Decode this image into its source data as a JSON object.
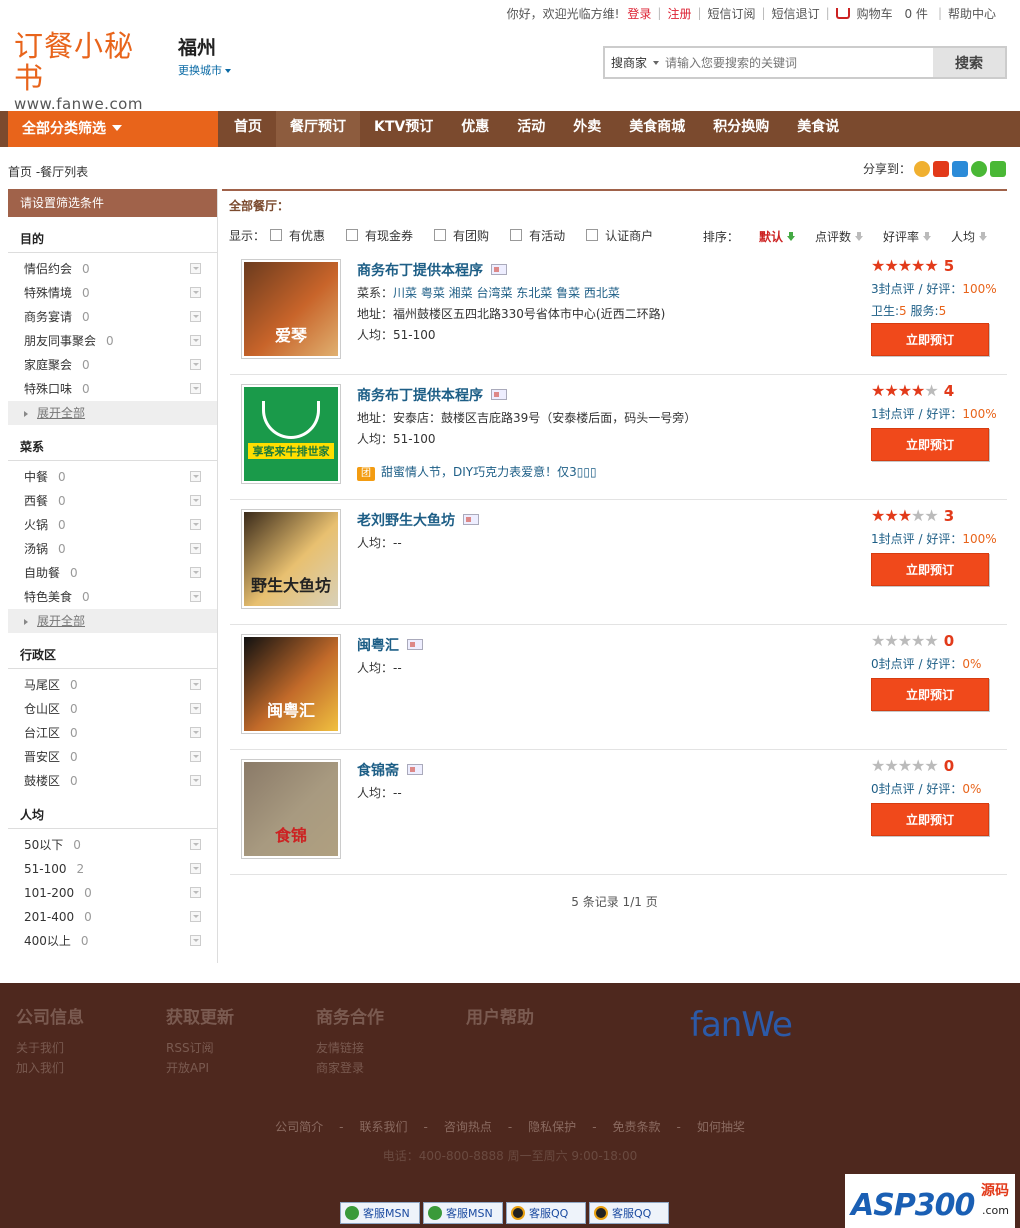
{
  "topbar": {
    "greeting": "你好，欢迎光临方维!",
    "login": "登录",
    "register": "注册",
    "sms_sub": "短信订阅",
    "sms_unsub": "短信退订",
    "cart": "购物车",
    "cart_count": "0 件",
    "help": "帮助中心"
  },
  "logo": {
    "cn": "订餐小秘书",
    "en": "www.fanwe.com"
  },
  "city": {
    "name": "福州",
    "change": "更换城市"
  },
  "search": {
    "scope": "搜商家",
    "placeholder": "请输入您要搜索的关键词",
    "button": "搜索"
  },
  "nav": {
    "all": "全部分类筛选",
    "items": [
      "首页",
      "餐厅预订",
      "KTV预订",
      "优惠",
      "活动",
      "外卖",
      "美食商城",
      "积分换购",
      "美食说"
    ]
  },
  "breadcrumb": "首页  -餐厅列表",
  "share_label": "分享到：",
  "sidebar": {
    "header": "请设置筛选条件",
    "expand_label": "展开全部",
    "groups": [
      {
        "title": "目的",
        "items": [
          {
            "label": "情侣约会",
            "count": "0"
          },
          {
            "label": "特殊情境",
            "count": "0"
          },
          {
            "label": "商务宴请",
            "count": "0"
          },
          {
            "label": "朋友同事聚会",
            "count": "0"
          },
          {
            "label": "家庭聚会",
            "count": "0"
          },
          {
            "label": "特殊口味",
            "count": "0"
          }
        ]
      },
      {
        "title": "菜系",
        "items": [
          {
            "label": "中餐",
            "count": "0"
          },
          {
            "label": "西餐",
            "count": "0"
          },
          {
            "label": "火锅",
            "count": "0"
          },
          {
            "label": "汤锅",
            "count": "0"
          },
          {
            "label": "自助餐",
            "count": "0"
          },
          {
            "label": "特色美食",
            "count": "0"
          }
        ]
      },
      {
        "title": "行政区",
        "items": [
          {
            "label": "马尾区",
            "count": "0"
          },
          {
            "label": "仓山区",
            "count": "0"
          },
          {
            "label": "台江区",
            "count": "0"
          },
          {
            "label": "晋安区",
            "count": "0"
          },
          {
            "label": "鼓楼区",
            "count": "0"
          }
        ]
      },
      {
        "title": "人均",
        "items": [
          {
            "label": "50以下",
            "count": "0"
          },
          {
            "label": "51-100",
            "count": "2"
          },
          {
            "label": "101-200",
            "count": "0"
          },
          {
            "label": "201-400",
            "count": "0"
          },
          {
            "label": "400以上",
            "count": "0"
          }
        ]
      }
    ]
  },
  "main": {
    "title": "全部餐厅：",
    "show_label": "显示：",
    "filters": [
      "有优惠",
      "有现金券",
      "有团购",
      "有活动",
      "认证商户"
    ],
    "sort_label": "排序：",
    "sorts": [
      "默认",
      "点评数",
      "好评率",
      "人均"
    ],
    "book_label": "立即预订",
    "restaurants": [
      {
        "name": "商务布丁提供本程序",
        "cuisine_label": "菜系：",
        "cuisine": "川菜 粤菜 湘菜 台湾菜 东北菜 鲁菜 西北菜",
        "address": "地址：福州鼓楼区五四北路330号省体市中心(近西二环路)",
        "avg": "人均：51-100",
        "rating": 5,
        "score": "5",
        "reviews": "3封点评",
        "good": "100%",
        "hygiene": "5",
        "service": "5",
        "thumb_text": "爱琴"
      },
      {
        "name": "商务布丁提供本程序",
        "address": "地址：安泰店：鼓楼区吉庇路39号（安泰楼后面，码头一号旁）",
        "avg": "人均：51-100",
        "promo": "甜蜜情人节，DIY巧克力表爱意！仅3▯▯▯",
        "rating": 4,
        "score": "4",
        "reviews": "1封点评",
        "good": "100%",
        "thumb_text": "享客来牛排世家"
      },
      {
        "name": "老刘野生大鱼坊",
        "avg": "人均：--",
        "rating": 3,
        "score": "3",
        "reviews": "1封点评",
        "good": "100%",
        "thumb_text": "野生大鱼坊"
      },
      {
        "name": "闽粤汇",
        "avg": "人均：--",
        "rating": 0,
        "score": "0",
        "reviews": "0封点评",
        "good": "0%",
        "thumb_text": "闽粤汇"
      },
      {
        "name": "食锦斋",
        "avg": "人均：--",
        "rating": 0,
        "score": "0",
        "reviews": "0封点评",
        "good": "0%",
        "thumb_text": "食锦"
      }
    ],
    "good_label": "好评：",
    "hygiene_label": "卫生:",
    "service_label": "服务:",
    "pager": "5 条记录   1/1 页"
  },
  "footer": {
    "cols": [
      {
        "title": "公司信息",
        "links": [
          "关于我们",
          "加入我们"
        ]
      },
      {
        "title": "获取更新",
        "links": [
          "RSS订阅",
          "开放API"
        ]
      },
      {
        "title": "商务合作",
        "links": [
          "友情链接",
          "商家登录"
        ]
      },
      {
        "title": "用户帮助",
        "links": []
      }
    ],
    "brand": "fanWe",
    "links": [
      "公司简介",
      "联系我们",
      "咨询热点",
      "隐私保护",
      "免责条款",
      "如何抽奖"
    ],
    "phone": "电话：400-800-8888 周一至周六  9:00-18:00",
    "support": [
      "客服MSN",
      "客服MSN",
      "客服QQ",
      "客服QQ"
    ],
    "badge": {
      "logo": "ASP300",
      "tag": "源码",
      "domain": ".com"
    }
  }
}
